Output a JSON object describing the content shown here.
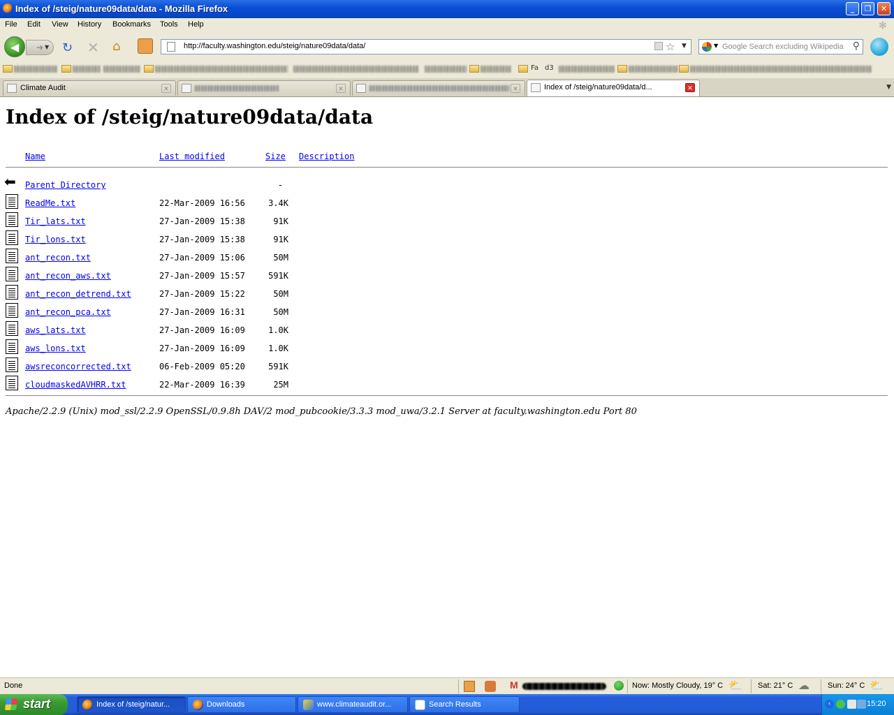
{
  "window": {
    "title": "Index of /steig/nature09data/data - Mozilla Firefox",
    "controls": {
      "minimize": "_",
      "maximize": "❐",
      "close": "✕"
    }
  },
  "menu": [
    "File",
    "Edit",
    "View",
    "History",
    "Bookmarks",
    "Tools",
    "Help"
  ],
  "nav": {
    "url": "http://faculty.washington.edu/steig/nature09data/data/",
    "search_placeholder": "Google Search excluding Wikipedia"
  },
  "bookmarks": {
    "visible_labels": [
      "Fa",
      "d3"
    ]
  },
  "tabs": [
    {
      "label": "Climate Audit",
      "active": false
    },
    {
      "label": "",
      "active": false
    },
    {
      "label": "",
      "active": false
    },
    {
      "label": "Index of /steig/nature09data/d...",
      "active": true
    }
  ],
  "page": {
    "heading": "Index of /steig/nature09data/data",
    "columns": {
      "name": "Name",
      "modified": "Last modified",
      "size": "Size",
      "description": "Description"
    },
    "parent": {
      "name": "Parent Directory",
      "size": "-"
    },
    "files": [
      {
        "name": "ReadMe.txt",
        "modified": "22-Mar-2009 16:56",
        "size": "3.4K"
      },
      {
        "name": "Tir_lats.txt",
        "modified": "27-Jan-2009 15:38",
        "size": "91K"
      },
      {
        "name": "Tir_lons.txt",
        "modified": "27-Jan-2009 15:38",
        "size": "91K"
      },
      {
        "name": "ant_recon.txt",
        "modified": "27-Jan-2009 15:06",
        "size": "50M"
      },
      {
        "name": "ant_recon_aws.txt",
        "modified": "27-Jan-2009 15:57",
        "size": "591K"
      },
      {
        "name": "ant_recon_detrend.txt",
        "modified": "27-Jan-2009 15:22",
        "size": "50M"
      },
      {
        "name": "ant_recon_pca.txt",
        "modified": "27-Jan-2009 16:31",
        "size": "50M"
      },
      {
        "name": "aws_lats.txt",
        "modified": "27-Jan-2009 16:09",
        "size": "1.0K"
      },
      {
        "name": "aws_lons.txt",
        "modified": "27-Jan-2009 16:09",
        "size": "1.0K"
      },
      {
        "name": "awsreconcorrected.txt",
        "modified": "06-Feb-2009 05:20",
        "size": "591K"
      },
      {
        "name": "cloudmaskedAVHRR.txt",
        "modified": "22-Mar-2009 16:39",
        "size": "25M"
      }
    ],
    "server_signature": "Apache/2.2.9 (Unix) mod_ssl/2.2.9 OpenSSL/0.9.8h DAV/2 mod_pubcookie/3.3.3 mod_uwa/3.2.1 Server at faculty.washington.edu Port 80"
  },
  "status": {
    "text": "Done",
    "weather_now": "Now: Mostly Cloudy, 19° C",
    "weather_sat": "Sat: 21° C",
    "weather_sun": "Sun: 24° C"
  },
  "taskbar": {
    "start": "start",
    "tasks": [
      {
        "label": "Index of /steig/natur...",
        "active": true
      },
      {
        "label": "Downloads",
        "active": false
      },
      {
        "label": "www.climateaudit.or...",
        "active": false
      },
      {
        "label": "Search Results",
        "active": false
      }
    ],
    "clock": "15:20"
  },
  "colors": {
    "link": "#0000ee",
    "titlebar": "#0a4fd6",
    "taskbar": "#245edb",
    "chrome": "#ece9d8"
  }
}
